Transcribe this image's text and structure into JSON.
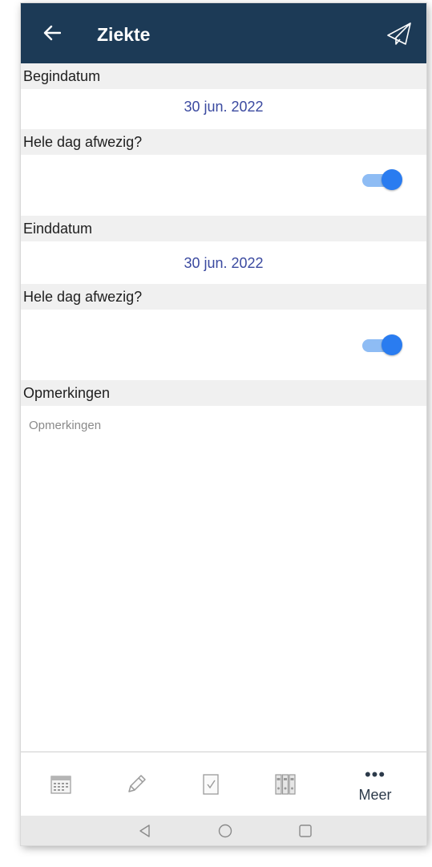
{
  "app_bar": {
    "title": "Ziekte",
    "back_icon": "arrow-left-icon",
    "send_icon": "paper-plane-icon",
    "background": "#1c3a56"
  },
  "form": {
    "start_date": {
      "label": "Begindatum",
      "value": "30 jun. 2022"
    },
    "start_all_day": {
      "label": "Hele dag afwezig?",
      "checked": true
    },
    "end_date": {
      "label": "Einddatum",
      "value": "30 jun. 2022"
    },
    "end_all_day": {
      "label": "Hele dag afwezig?",
      "checked": true
    },
    "notes": {
      "label": "Opmerkingen",
      "placeholder": "Opmerkingen",
      "value": ""
    }
  },
  "bottom_nav": {
    "items": [
      {
        "icon": "calendar-icon"
      },
      {
        "icon": "pencil-icon"
      },
      {
        "icon": "checklist-icon"
      },
      {
        "icon": "binders-icon"
      },
      {
        "icon": "more-dots-icon",
        "label": "Meer"
      }
    ]
  },
  "system_nav": {
    "buttons": [
      "back-triangle-icon",
      "home-circle-icon",
      "recents-square-icon"
    ]
  },
  "colors": {
    "accent": "#2a7cf0",
    "date_text": "#3b4aa0",
    "section_bg": "#f0f0f0"
  }
}
